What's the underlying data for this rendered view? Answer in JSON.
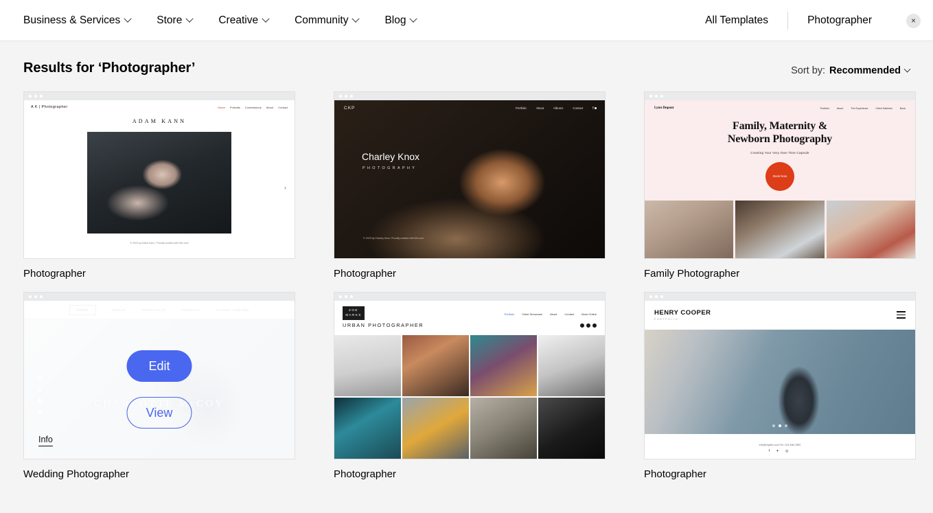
{
  "topnav": {
    "menus": [
      {
        "label": "Business & Services",
        "icon": "chevron-down-icon"
      },
      {
        "label": "Store",
        "icon": "chevron-down-icon"
      },
      {
        "label": "Creative",
        "icon": "chevron-down-icon"
      },
      {
        "label": "Community",
        "icon": "chevron-down-icon"
      },
      {
        "label": "Blog",
        "icon": "chevron-down-icon"
      }
    ],
    "all_templates": "All Templates",
    "current": "Photographer",
    "close_icon": "×"
  },
  "results": {
    "title": "Results for ‘Photographer’",
    "sort_prefix": "Sort by:",
    "sort_value": "Recommended"
  },
  "colors": {
    "accent_blue": "#4a67f0",
    "page_bg": "#f4f4f4",
    "chrome_bg": "#e9eaec",
    "book_now_red": "#dd3d18",
    "pink_bg": "#fbeced"
  },
  "cards": [
    {
      "label": "Photographer",
      "site": {
        "logo": "A K",
        "logo_sub": "| Photographer",
        "nav": [
          "Home",
          "Portraits",
          "Commissions",
          "About",
          "Contact"
        ],
        "title": "ADAM KANN",
        "footer": "© 2023 by Adam Kann. Proudly created with Wix.com",
        "arrow_icon": "chevron-right-icon"
      }
    },
    {
      "label": "Photographer",
      "site": {
        "logo": "CKP",
        "nav": [
          "Portfolio",
          "About",
          "Albums",
          "Contact"
        ],
        "social": [
          "facebook-icon",
          "instagram-icon"
        ],
        "title": "Charley Knox",
        "subtitle": "PHOTOGRAPHY",
        "footer": "© 2023 by Charley Knox. Proudly created with Wix.com"
      }
    },
    {
      "label": "Family Photographer",
      "site": {
        "logo": "Lynn Dupont",
        "nav": [
          "Portfolio",
          "About",
          "The Experience",
          "Client Galleries",
          "Book"
        ],
        "title_line1": "Family, Maternity &",
        "title_line2": "Newborn Photography",
        "tagline": "Creating Your Very Own Time Capsule",
        "button": "Book Now"
      }
    },
    {
      "label": "Wedding Photographer",
      "hovered": true,
      "site": {
        "nav": [
          "HOME",
          "ABOUT",
          "PORTFOLIO",
          "CONTACT",
          "CLIENT ALBUMS"
        ],
        "title": "CHARLOTTE McCOY",
        "subtitle": "WEDDING PHOTOGRAPHY"
      },
      "overlay": {
        "edit": "Edit",
        "view": "View",
        "info": "Info"
      }
    },
    {
      "label": "Photographer",
      "site": {
        "logo_line1": "ZOE",
        "logo_line2": "MARKS",
        "nav": [
          "Portfolio",
          "Client Showcase",
          "About",
          "Contact",
          "Book Online"
        ],
        "heading": "URBAN PHOTOGRAPHER",
        "social": [
          "facebook-icon",
          "twitter-icon",
          "instagram-icon"
        ]
      }
    },
    {
      "label": "Photographer",
      "site": {
        "name": "HENRY COOPER",
        "subtitle": "PORTFOLIO",
        "menu_icon": "hamburger-icon",
        "contact": "info@mysite.com     Tel: 123-456-7890",
        "social": "f  ✦  ◎"
      }
    }
  ]
}
